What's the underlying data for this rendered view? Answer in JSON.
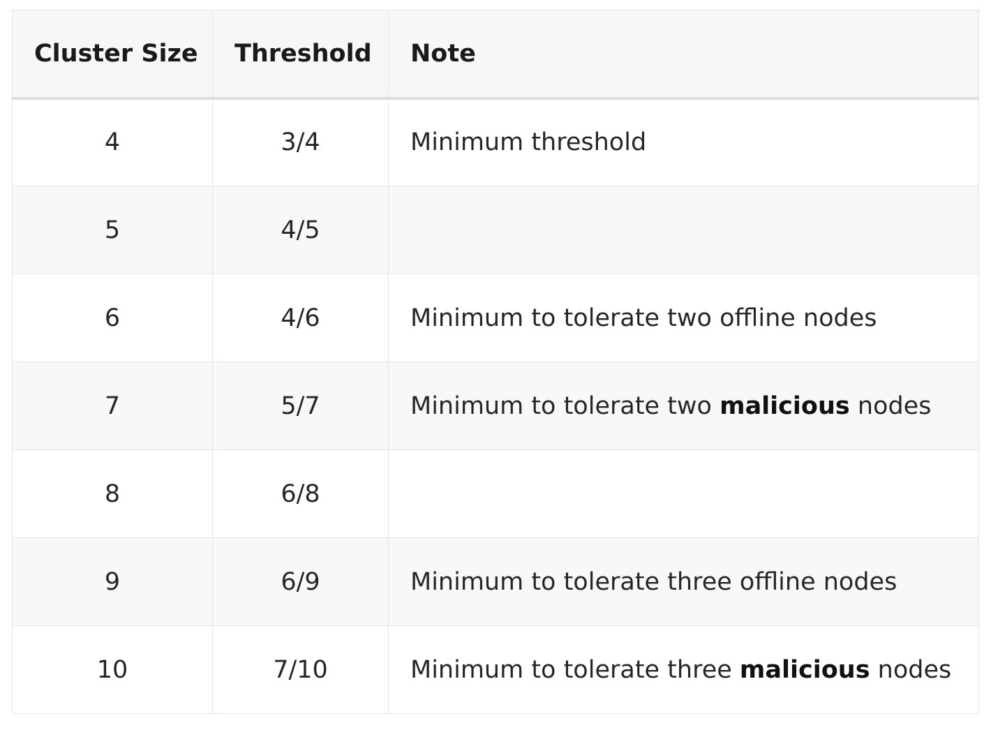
{
  "table": {
    "headers": [
      "Cluster Size",
      "Threshold",
      "Note"
    ],
    "rows": [
      {
        "size": "4",
        "threshold": "3/4",
        "note_pre": "Minimum threshold",
        "note_bold": "",
        "note_post": ""
      },
      {
        "size": "5",
        "threshold": "4/5",
        "note_pre": "",
        "note_bold": "",
        "note_post": ""
      },
      {
        "size": "6",
        "threshold": "4/6",
        "note_pre": "Minimum to tolerate two offline nodes",
        "note_bold": "",
        "note_post": ""
      },
      {
        "size": "7",
        "threshold": "5/7",
        "note_pre": "Minimum to tolerate two ",
        "note_bold": "malicious",
        "note_post": " nodes"
      },
      {
        "size": "8",
        "threshold": "6/8",
        "note_pre": "",
        "note_bold": "",
        "note_post": ""
      },
      {
        "size": "9",
        "threshold": "6/9",
        "note_pre": "Minimum to tolerate three offline nodes",
        "note_bold": "",
        "note_post": ""
      },
      {
        "size": "10",
        "threshold": "7/10",
        "note_pre": "Minimum to tolerate three ",
        "note_bold": "malicious",
        "note_post": " nodes"
      }
    ]
  }
}
